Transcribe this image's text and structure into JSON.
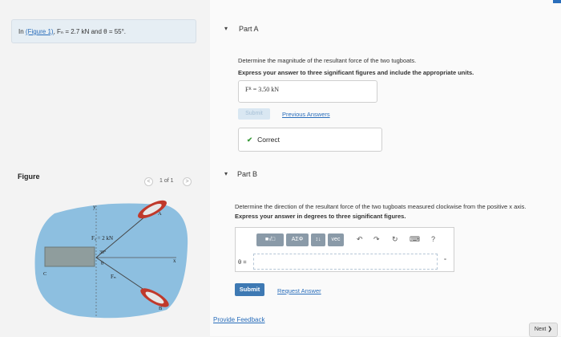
{
  "problem": {
    "prefix": "In ",
    "figure_link": "(Figure 1)",
    "statement": ", Fₙ = 2.7 kN and θ = 55°."
  },
  "figure": {
    "label": "Figure",
    "pager": "1 of 1",
    "prev": "<",
    "next": ">",
    "labels": {
      "fa": "Fₐ = 2 kN",
      "angle30": "30°",
      "theta": "θ",
      "fb": "Fₙ",
      "axis_x": "x",
      "axis_y": "y",
      "point_a": "A",
      "point_b": "B",
      "point_c": "C"
    }
  },
  "partA": {
    "toggle": "▾",
    "title": "Part A",
    "question": "Determine the magnitude of the resultant force of the two tugboats.",
    "instruction": "Express your answer to three significant figures and include the appropriate units.",
    "answer_label": "Fᴿ =",
    "answer_value": "3.50 kN",
    "submit": "Submit",
    "previous_answers": "Previous Answers",
    "result_icon": "✔",
    "result_text": "Correct"
  },
  "partB": {
    "toggle": "▾",
    "title": "Part B",
    "question": "Determine the direction of the resultant force of the two tugboats measured clockwise from the positive x axis.",
    "instruction": "Express your answer in degrees to three significant figures.",
    "toolbar": {
      "sqrt": "■√□",
      "greek": "AΣΦ",
      "arrows": "↕↓",
      "vec": "vec",
      "undo": "↶",
      "redo": "↷",
      "reset": "↻",
      "keyboard": "⌨",
      "help": "?"
    },
    "answer_label": "θ =",
    "answer_unit": "°",
    "submit": "Submit",
    "request_answer": "Request Answer"
  },
  "footer": {
    "feedback": "Provide Feedback",
    "next": "Next ❯"
  },
  "colors": {
    "water": "#8dbfe0",
    "accent": "#3e79b3",
    "correct": "#3b9b3b"
  }
}
